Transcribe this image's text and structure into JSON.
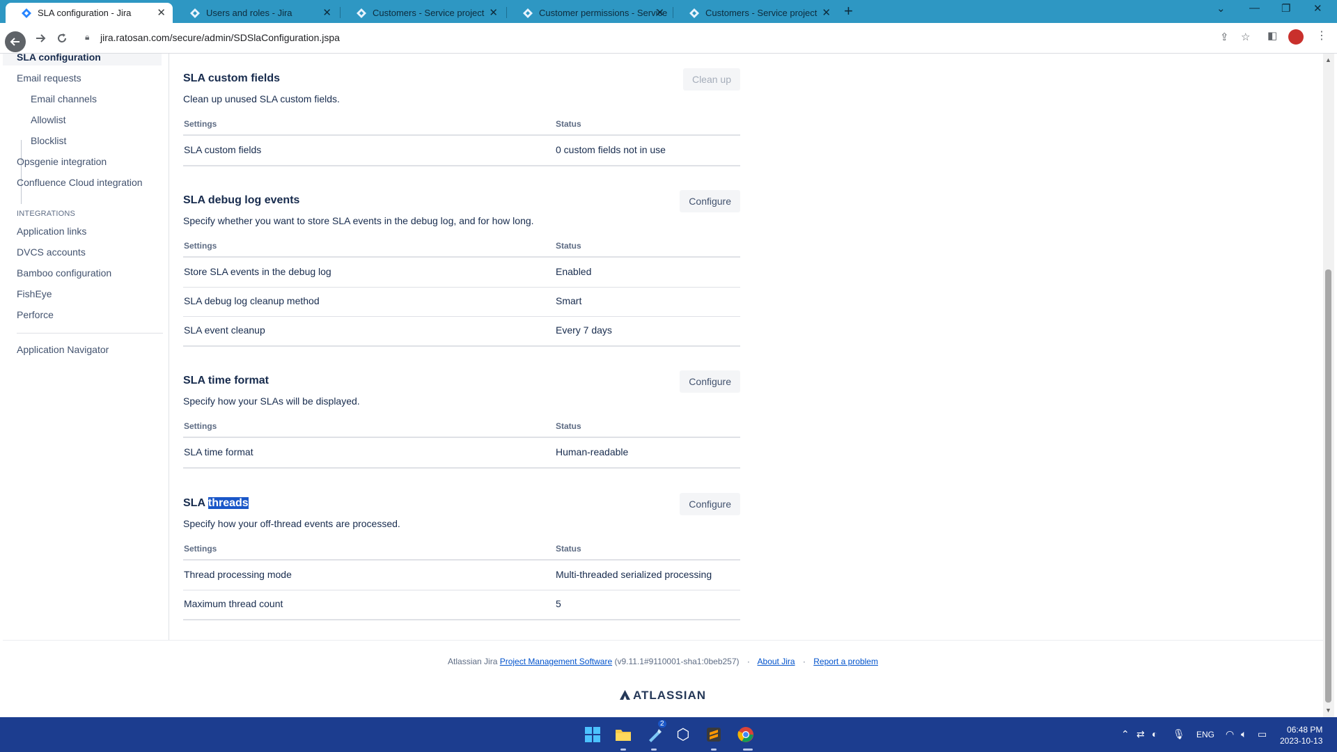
{
  "browser": {
    "tabs": [
      {
        "title": "SLA configuration - Jira",
        "active": true
      },
      {
        "title": "Users and roles - Jira",
        "active": false
      },
      {
        "title": "Customers - Service project",
        "active": false
      },
      {
        "title": "Customer permissions - Service",
        "active": false
      },
      {
        "title": "Customers - Service project",
        "active": false
      }
    ],
    "url": "jira.ratosan.com/secure/admin/SDSlaConfiguration.jspa",
    "tab_close": "✕",
    "new_tab": "+"
  },
  "sidebar": {
    "items_top": [
      {
        "label": "SLA configuration",
        "active": true
      },
      {
        "label": "Email requests"
      },
      {
        "label": "Email channels",
        "sub": true
      },
      {
        "label": "Allowlist",
        "sub": true
      },
      {
        "label": "Blocklist",
        "sub": true
      },
      {
        "label": "Opsgenie integration"
      },
      {
        "label": "Confluence Cloud integration"
      }
    ],
    "integrations_heading": "INTEGRATIONS",
    "integrations": [
      {
        "label": "Application links"
      },
      {
        "label": "DVCS accounts"
      },
      {
        "label": "Bamboo configuration"
      },
      {
        "label": "FishEye"
      },
      {
        "label": "Perforce"
      }
    ],
    "app_navigator": "Application Navigator"
  },
  "sections": [
    {
      "title": "SLA custom fields",
      "description": "Clean up unused SLA custom fields.",
      "button": "Clean up",
      "button_disabled": true,
      "headers": [
        "Settings",
        "Status"
      ],
      "rows": [
        [
          "SLA custom fields",
          "0 custom fields not in use"
        ]
      ]
    },
    {
      "title": "SLA debug log events",
      "description": "Specify whether you want to store SLA events in the debug log, and for how long.",
      "button": "Configure",
      "headers": [
        "Settings",
        "Status"
      ],
      "rows": [
        [
          "Store SLA events in the debug log",
          "Enabled"
        ],
        [
          "SLA debug log cleanup method",
          "Smart"
        ],
        [
          "SLA event cleanup",
          "Every 7 days"
        ]
      ]
    },
    {
      "title": "SLA time format",
      "description": "Specify how your SLAs will be displayed.",
      "button": "Configure",
      "headers": [
        "Settings",
        "Status"
      ],
      "rows": [
        [
          "SLA time format",
          "Human-readable"
        ]
      ]
    },
    {
      "title_part1": "SLA ",
      "title_part2": "threads",
      "description": "Specify how your off-thread events are processed.",
      "button": "Configure",
      "headers": [
        "Settings",
        "Status"
      ],
      "rows": [
        [
          "Thread processing mode",
          "Multi-threaded serialized processing"
        ],
        [
          "Maximum thread count",
          "5"
        ]
      ]
    }
  ],
  "footer": {
    "prefix": "Atlassian Jira ",
    "link_pms": "Project Management Software",
    "version": " (v9.11.1#9110001-sha1:0beb257)",
    "about": "About Jira",
    "report": "Report a problem",
    "logo": "ATLASSIAN"
  },
  "taskbar": {
    "badge": "2",
    "language": "ENG",
    "time": "06:48 PM",
    "date": "2023-10-13"
  },
  "colors": {
    "tabstrip": "#2e97c3",
    "taskbar": "#1c3d8f",
    "selection": "#1a57c8",
    "link": "#0052cc"
  }
}
